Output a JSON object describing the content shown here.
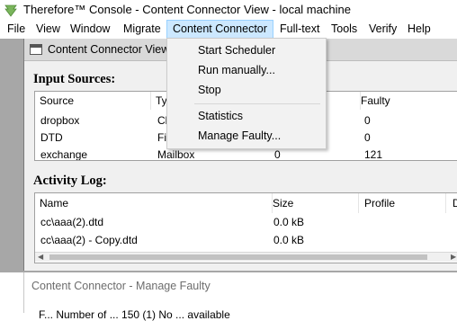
{
  "window": {
    "title": "Therefore™ Console - Content Connector View - local machine"
  },
  "menubar": {
    "items": [
      "File",
      "View",
      "Window",
      "Migrate",
      "Content Connector",
      "Full-text",
      "Tools",
      "Verify",
      "Help"
    ],
    "active": "Content Connector"
  },
  "child": {
    "title": "Content Connector View"
  },
  "input_sources": {
    "title": "Input Sources:",
    "columns": [
      "Source",
      "Type",
      "",
      "Faulty"
    ],
    "rows": [
      {
        "source": "dropbox",
        "type": "Cl",
        "count": "",
        "faulty": "0"
      },
      {
        "source": "DTD",
        "type": "Fil",
        "count": "",
        "faulty": "0"
      },
      {
        "source": "exchange",
        "type": "Mailbox",
        "count": "0",
        "faulty": "121"
      }
    ]
  },
  "activity_log": {
    "title": "Activity Log:",
    "columns": [
      "Name",
      "Size",
      "Profile",
      "D"
    ],
    "rows": [
      {
        "name": "cc\\aaa(2).dtd",
        "size": "0.0 kB",
        "profile": ""
      },
      {
        "name": "cc\\aaa(2) - Copy.dtd",
        "size": "0.0 kB",
        "profile": ""
      }
    ]
  },
  "dropdown": {
    "items": [
      "Start Scheduler",
      "Run manually...",
      "Stop",
      "Statistics",
      "Manage Faulty..."
    ]
  },
  "dialog": {
    "title": "Content Connector - Manage Faulty",
    "body": "F... Number of ... 150 (1) No ... available"
  },
  "colors": {
    "menu_highlight": "#cce8ff",
    "mdi_background": "#a7a7a7",
    "logo_green": "#7ab55c"
  }
}
